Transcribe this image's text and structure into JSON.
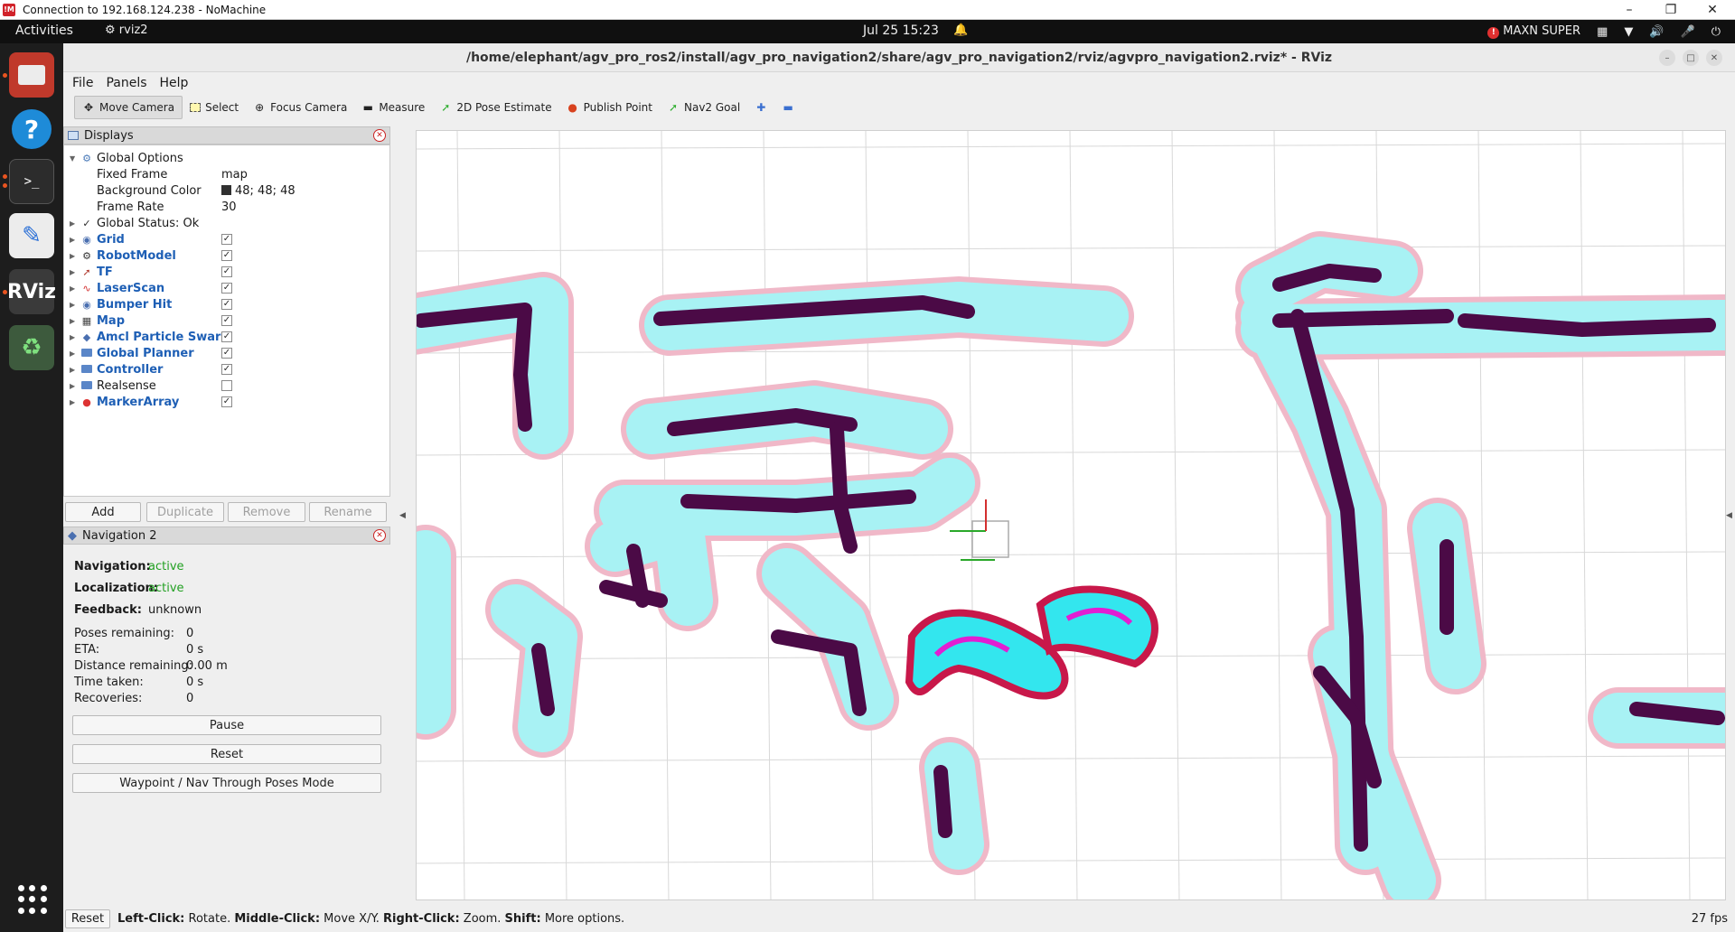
{
  "nomachine": {
    "title": "Connection to 192.168.124.238 - NoMachine"
  },
  "topbar": {
    "activities": "Activities",
    "app": "rviz2",
    "clock": "Jul 25  15:23",
    "power_mode": "MAXN SUPER"
  },
  "rviz": {
    "title": "/home/elephant/agv_pro_ros2/install/agv_pro_navigation2/share/agv_pro_navigation2/rviz/agvpro_navigation2.rviz* - RViz",
    "menu": [
      "File",
      "Panels",
      "Help"
    ],
    "tools": [
      {
        "label": "Move Camera",
        "icon": "move-camera-icon"
      },
      {
        "label": "Select",
        "icon": "select-icon"
      },
      {
        "label": "Focus Camera",
        "icon": "focus-camera-icon"
      },
      {
        "label": "Measure",
        "icon": "measure-icon"
      },
      {
        "label": "2D Pose Estimate",
        "icon": "pose-estimate-icon"
      },
      {
        "label": "Publish Point",
        "icon": "publish-point-icon"
      },
      {
        "label": "Nav2 Goal",
        "icon": "nav2-goal-icon"
      }
    ]
  },
  "displays": {
    "title": "Displays",
    "global_options": {
      "label": "Global Options",
      "fixed_frame_label": "Fixed Frame",
      "fixed_frame": "map",
      "bg_label": "Background Color",
      "bg_value": "48; 48; 48",
      "frame_rate_label": "Frame Rate",
      "frame_rate": "30"
    },
    "global_status": "Global Status: Ok",
    "items": [
      {
        "label": "Grid",
        "checked": true
      },
      {
        "label": "RobotModel",
        "checked": true
      },
      {
        "label": "TF",
        "checked": true
      },
      {
        "label": "LaserScan",
        "checked": true
      },
      {
        "label": "Bumper Hit",
        "checked": true
      },
      {
        "label": "Map",
        "checked": true
      },
      {
        "label": "Amcl Particle Swarm",
        "checked": true
      },
      {
        "label": "Global Planner",
        "checked": true
      },
      {
        "label": "Controller",
        "checked": true
      },
      {
        "label": "Realsense",
        "checked": false
      },
      {
        "label": "MarkerArray",
        "checked": true
      }
    ],
    "buttons": {
      "add": "Add",
      "duplicate": "Duplicate",
      "remove": "Remove",
      "rename": "Rename"
    }
  },
  "nav2": {
    "title": "Navigation 2",
    "navigation_label": "Navigation:",
    "navigation": "active",
    "localization_label": "Localization:",
    "localization": "active",
    "feedback_label": "Feedback:",
    "feedback": "unknown",
    "poses_label": "Poses remaining:",
    "poses": "0",
    "eta_label": "ETA:",
    "eta": "0 s",
    "distance_label": "Distance remaining:",
    "distance": "0.00 m",
    "time_label": "Time taken:",
    "time": "0 s",
    "recoveries_label": "Recoveries:",
    "recoveries": "0",
    "pause": "Pause",
    "reset": "Reset",
    "waypoint": "Waypoint / Nav Through Poses Mode"
  },
  "statusbar": {
    "reset": "Reset",
    "hint_left_b": "Left-Click:",
    "hint_left": " Rotate. ",
    "hint_mid_b": "Middle-Click:",
    "hint_mid": " Move X/Y. ",
    "hint_right_b": "Right-Click:",
    "hint_right": " Zoom. ",
    "hint_shift_b": "Shift:",
    "hint_shift": " More options.",
    "fps": "27 fps"
  },
  "colors": {
    "obstacle": "#4b0a46",
    "inflation": "#a8f2f4",
    "inflation_edge": "#f0b8c8",
    "costmap_local": "#33e6ee",
    "costmap_high": "#e21ed2",
    "costmap_lethal": "#c8184a",
    "grid": "#d8d8d8"
  }
}
